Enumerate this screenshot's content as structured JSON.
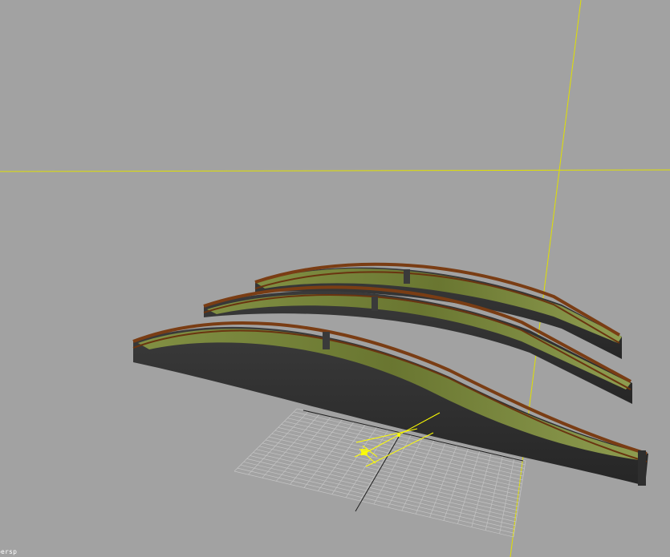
{
  "viewport": {
    "label": "persp",
    "background": "#a2a2a2",
    "axis_color": "#ffff00",
    "grid_color": "#c8c8c8"
  },
  "scene": {
    "objects": [
      {
        "name": "bridge-back",
        "deck_color": "#6d7a2e",
        "rail_color": "#7a3d14"
      },
      {
        "name": "bridge-middle",
        "deck_color": "#6d7a2e",
        "rail_color": "#7a3d14"
      },
      {
        "name": "bridge-front",
        "deck_color": "#6d7a2e",
        "rail_color": "#7a3d14"
      }
    ],
    "gizmo": "move-gizmo-icon"
  }
}
